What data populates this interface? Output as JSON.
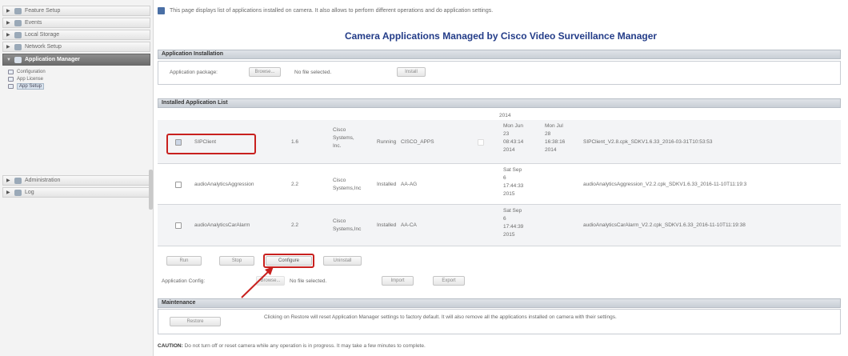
{
  "sidebar": {
    "items": [
      {
        "label": "Feature Setup",
        "icon": "feature-icon"
      },
      {
        "label": "Events",
        "icon": "events-icon"
      },
      {
        "label": "Local Storage",
        "icon": "storage-icon"
      },
      {
        "label": "Network Setup",
        "icon": "network-icon"
      },
      {
        "label": "Application Manager",
        "icon": "app-manager-icon"
      },
      {
        "label": "Administration",
        "icon": "admin-icon"
      },
      {
        "label": "Log",
        "icon": "log-icon"
      }
    ],
    "sub_items": [
      "Configuration",
      "App License",
      "App Setup"
    ]
  },
  "main": {
    "intro": "This page displays list of applications installed on camera. It also allows to perform different operations and do application settings.",
    "title": "Camera Applications Managed by Cisco Video Surveillance Manager",
    "install": {
      "header": "Application Installation",
      "package_label": "Application package:",
      "browse": "Browse...",
      "no_file": "No file selected.",
      "install": "Install"
    },
    "list": {
      "header": "Installed Application List",
      "top_date": "2014",
      "rows": [
        {
          "name": "SIPClient",
          "version": "1.6",
          "vendor": [
            "Cisco",
            "Systems,",
            "Inc."
          ],
          "status": "Running",
          "user": "CISCO_APPS",
          "start": [
            "Mon Jun",
            "23",
            "08:43:14",
            "2014"
          ],
          "end": [
            "Mon Jul",
            "28",
            "16:38:16",
            "2014"
          ],
          "file": "SIPClient_V2.8.cpk_SDKV1.6.33_2016-03-31T10:53:53"
        },
        {
          "name": "audioAnalyticsAggression",
          "version": "2.2",
          "vendor": [
            "Cisco",
            "Systems,Inc"
          ],
          "status": "Installed",
          "user": "AA-AG",
          "start": [
            "Sat Sep",
            "6",
            "17:44:33",
            "2015"
          ],
          "end": [],
          "file": "audioAnalyticsAggression_V2.2.cpk_SDKV1.6.33_2016-11-10T11:19:3"
        },
        {
          "name": "audioAnalyticsCarAlarm",
          "version": "2.2",
          "vendor": [
            "Cisco",
            "Systems,Inc"
          ],
          "status": "Installed",
          "user": "AA-CA",
          "start": [
            "Sat Sep",
            "6",
            "17:44:39",
            "2015"
          ],
          "end": [],
          "file": "audioAnalyticsCarAlarm_V2.2.cpk_SDKV1.6.33_2016-11-10T11:19:38"
        }
      ],
      "actions": {
        "run": "Run",
        "stop": "Stop",
        "configure": "Configure",
        "uninstall": "Uninstall"
      },
      "config": {
        "label": "Application Config:",
        "browse": "Browse...",
        "no_file": "No file selected.",
        "import": "Import",
        "export": "Export"
      }
    },
    "maintenance": {
      "header": "Maintenance",
      "restore": "Restore",
      "text": "Clicking on Restore will reset Application Manager settings to factory default. It will also remove all the applications installed on camera with their settings."
    },
    "caution_label": "CAUTION:",
    "caution_text": "Do not turn off or reset camera while any operation is in progress. It may take a few minutes to complete."
  },
  "colors": {
    "title": "#233c88",
    "highlight": "#c8201e",
    "active_nav": "#777777"
  }
}
